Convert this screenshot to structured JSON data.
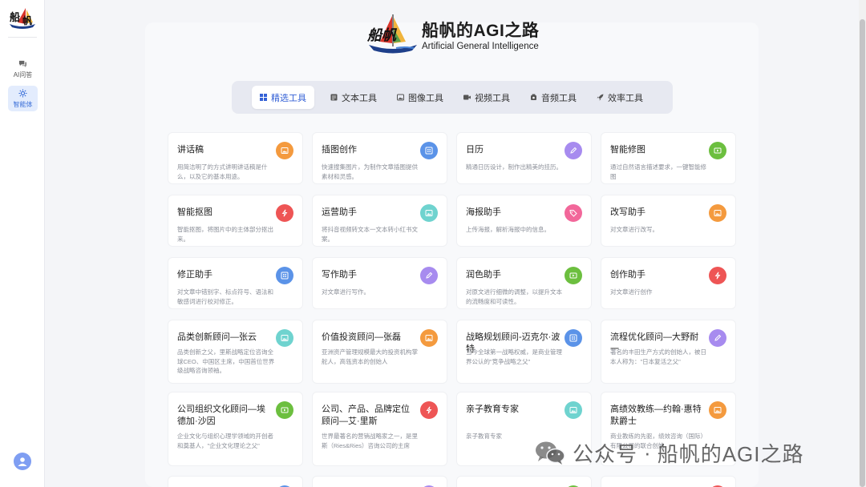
{
  "sidebar": {
    "items": [
      {
        "label": "AI问答",
        "icon": "chat-icon",
        "active": false
      },
      {
        "label": "智能体",
        "icon": "agent-icon",
        "active": true
      }
    ]
  },
  "brand": {
    "title": "船帆的AGI之路",
    "subtitle": "Artificial General Intelligence",
    "logo_text": "船帆"
  },
  "tabs": [
    {
      "label": "精选工具",
      "icon": "grid-icon",
      "active": true
    },
    {
      "label": "文本工具",
      "icon": "document-icon",
      "active": false
    },
    {
      "label": "图像工具",
      "icon": "image-icon",
      "active": false
    },
    {
      "label": "视频工具",
      "icon": "video-icon",
      "active": false
    },
    {
      "label": "音频工具",
      "icon": "audio-icon",
      "active": false
    },
    {
      "label": "效率工具",
      "icon": "rocket-icon",
      "active": false
    }
  ],
  "cards": [
    {
      "title": "讲话稿",
      "desc": "用简洁明了的方式讲明讲话稿是什么，以及它的基本用途。",
      "icon": "image-icon",
      "color": "#f49a3e"
    },
    {
      "title": "插图创作",
      "desc": "快速搜集图片，为制作文章插图提供素材和灵感。",
      "icon": "grid-icon",
      "color": "#5b93e8"
    },
    {
      "title": "日历",
      "desc": "精通日历设计，制作出精美的挂历。",
      "icon": "pencil-icon",
      "color": "#a78bef"
    },
    {
      "title": "智能修图",
      "desc": "通过自然语言描述要求，一键智能修图",
      "icon": "video-icon",
      "color": "#6cbf3f"
    },
    {
      "title": "智能抠图",
      "desc": "智能抠图，将图片中的主体部分抠出来。",
      "icon": "bolt-icon",
      "color": "#ee5555"
    },
    {
      "title": "运营助手",
      "desc": "将抖音视频转文本一文本转小红书文案。",
      "icon": "image-icon",
      "color": "#6fd3cf"
    },
    {
      "title": "海报助手",
      "desc": "上传海报，解析海报中的信息。",
      "icon": "tag-icon",
      "color": "#f2679a"
    },
    {
      "title": "改写助手",
      "desc": "对文章进行改写。",
      "icon": "image-icon",
      "color": "#f49a3e"
    },
    {
      "title": "修正助手",
      "desc": "对文章中错别字、标点符号、语法和敏感词进行校对修正。",
      "icon": "grid-icon",
      "color": "#5b93e8"
    },
    {
      "title": "写作助手",
      "desc": "对文章进行写作。",
      "icon": "pencil-icon",
      "color": "#a78bef"
    },
    {
      "title": "润色助手",
      "desc": "对原文进行细微的调整，以提升文本的流畅度和可读性。",
      "icon": "video-icon",
      "color": "#6cbf3f"
    },
    {
      "title": "创作助手",
      "desc": "对文章进行创作",
      "icon": "bolt-icon",
      "color": "#ee5555"
    },
    {
      "title": "品类创新顾问—张云",
      "desc": "品类创新之父，里斯战略定位咨询全球CEO、中国区主席，中国首位世界级战略咨询领袖。",
      "icon": "image-icon",
      "color": "#6fd3cf"
    },
    {
      "title": "价值投资顾问—张磊",
      "desc": "亚洲资产管理规模最大的投资机构掌舵人，高瓴资本的创始人",
      "icon": "image-icon",
      "color": "#f49a3e"
    },
    {
      "title": "战略规划顾问-迈克尔·波特",
      "desc": "当今全球第一战略权威，是商业管理界公认的\"竞争战略之父\"",
      "icon": "grid-icon",
      "color": "#5b93e8"
    },
    {
      "title": "流程优化顾问—大野耐一",
      "desc": "著名的丰田生产方式的创始人，被日本人称为：\"日本复活之父\"",
      "icon": "pencil-icon",
      "color": "#a78bef"
    },
    {
      "title": "公司组织文化顾问—埃德加·沙因",
      "desc": "企业文化与组织心理学领域的开创者和奠基人，\"企业文化理论之父\"",
      "icon": "video-icon",
      "color": "#6cbf3f"
    },
    {
      "title": "公司、产品、品牌定位顾问—艾·里斯",
      "desc": "世界最著名的营销战略家之一，是里斯（Ries&Ries）咨询公司的主席",
      "icon": "bolt-icon",
      "color": "#ee5555"
    },
    {
      "title": "亲子教育专家",
      "desc": "亲子教育专家",
      "icon": "image-icon",
      "color": "#6fd3cf"
    },
    {
      "title": "高绩效教练—约翰·惠特默爵士",
      "desc": "商业教练的先驱，绩效咨询（国际）有限公司的联合创始",
      "icon": "image-icon",
      "color": "#f49a3e"
    },
    {
      "title": "",
      "desc": "",
      "icon": "grid-icon",
      "color": "#5b93e8"
    },
    {
      "title": "",
      "desc": "",
      "icon": "pencil-icon",
      "color": "#a78bef"
    },
    {
      "title": "",
      "desc": "",
      "icon": "video-icon",
      "color": "#6cbf3f"
    },
    {
      "title": "",
      "desc": "",
      "icon": "bolt-icon",
      "color": "#ee5555"
    }
  ],
  "watermark": {
    "prefix": "公众号",
    "separator": "·",
    "name": "船帆的AGI之路",
    "icon": "wechat-icon"
  }
}
